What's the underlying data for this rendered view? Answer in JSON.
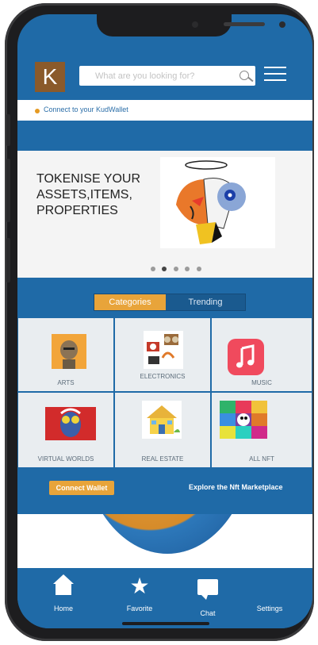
{
  "header": {
    "logo_letter": "K",
    "search_placeholder": "What are you looking for?"
  },
  "wallet": {
    "connect_text": "Connect to your KudWallet"
  },
  "banner": {
    "headline": "TOKENISE YOUR ASSETS,ITEMS, PROPERTIES",
    "carousel_pages": 5,
    "active_page": 2
  },
  "tabs": {
    "categories": "Categories",
    "trending": "Trending"
  },
  "categories": [
    {
      "label": "ARTS"
    },
    {
      "label": "ELECTRONICS"
    },
    {
      "label": "MUSIC"
    },
    {
      "label": "VIRTUAL WORLDS"
    },
    {
      "label": "REAL ESTATE"
    },
    {
      "label": "ALL NFT"
    }
  ],
  "cta": {
    "connect_wallet": "Connect Wallet",
    "explore": "Explore the Nft Marketplace"
  },
  "tabbar": {
    "home": "Home",
    "favorite": "Favorite",
    "chat": "Chat",
    "settings": "Settings"
  },
  "colors": {
    "primary_blue": "#1f6aa7",
    "accent_orange": "#e8a43a",
    "logo_brown": "#8a5a2b"
  }
}
